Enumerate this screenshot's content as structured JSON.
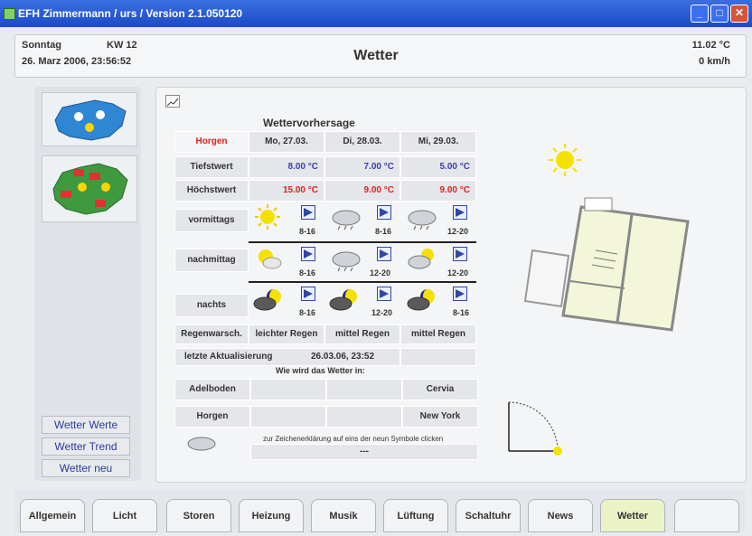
{
  "window": {
    "title": "EFH Zimmermann / urs / Version 2.1.050120"
  },
  "header": {
    "day": "Sonntag",
    "kw": "KW  12",
    "datetime": "26. Marz 2006, 23:56:52",
    "title": "Wetter",
    "temperature": "11.02 °C",
    "wind": "0 km/h"
  },
  "left": {
    "buttons": [
      "Wetter Werte",
      "Wetter Trend",
      "Wetter neu"
    ]
  },
  "forecast": {
    "title": "Wettervorhersage",
    "location": "Horgen",
    "days": [
      "Mo, 27.03.",
      "Di, 28.03.",
      "Mi, 29.03."
    ],
    "tiefstwert_label": "Tiefstwert",
    "tiefstwert": [
      "8.00 °C",
      "7.00 °C",
      "5.00 °C"
    ],
    "hoechstwert_label": "Höchstwert",
    "hoechstwert": [
      "15.00 °C",
      "9.00 °C",
      "9.00 °C"
    ],
    "periods": [
      {
        "label": "vormittags",
        "icons": [
          "sun-icon",
          "cloud-rain-icon",
          "cloud-rain-icon"
        ],
        "winds": [
          "8-16",
          "8-16",
          "12-20"
        ]
      },
      {
        "label": "nachmittag",
        "icons": [
          "sun-cloud-icon",
          "cloud-rain-icon",
          "sun-cloud-icon"
        ],
        "winds": [
          "8-16",
          "12-20",
          "12-20"
        ]
      },
      {
        "label": "nachts",
        "icons": [
          "night-cloud-icon",
          "night-cloud-icon",
          "night-cloud-icon"
        ],
        "winds": [
          "8-16",
          "12-20",
          "8-16"
        ]
      }
    ],
    "regen_label": "Regenwarsch.",
    "regen": [
      "leichter Regen",
      "mittel Regen",
      "mittel Regen"
    ],
    "update_label": "letzte Aktualisierung",
    "update_value": "26.03.06, 23:52",
    "question": "Wie wird das Wetter in:",
    "places": [
      "Adelboden",
      "Cervia",
      "Horgen",
      "New York"
    ],
    "hint": "zur Zeichenerklärung auf eins der neun Symbole clicken",
    "hint_value": "---"
  },
  "tabs": [
    "Allgemein",
    "Licht",
    "Storen",
    "Heizung",
    "Musik",
    "Lüftung",
    "Schaltuhr",
    "News",
    "Wetter",
    ""
  ],
  "colors": {
    "accent": "#ebf3c6",
    "sun": "#f5e100",
    "red": "#e0201d",
    "blue": "#3b3fa8"
  }
}
